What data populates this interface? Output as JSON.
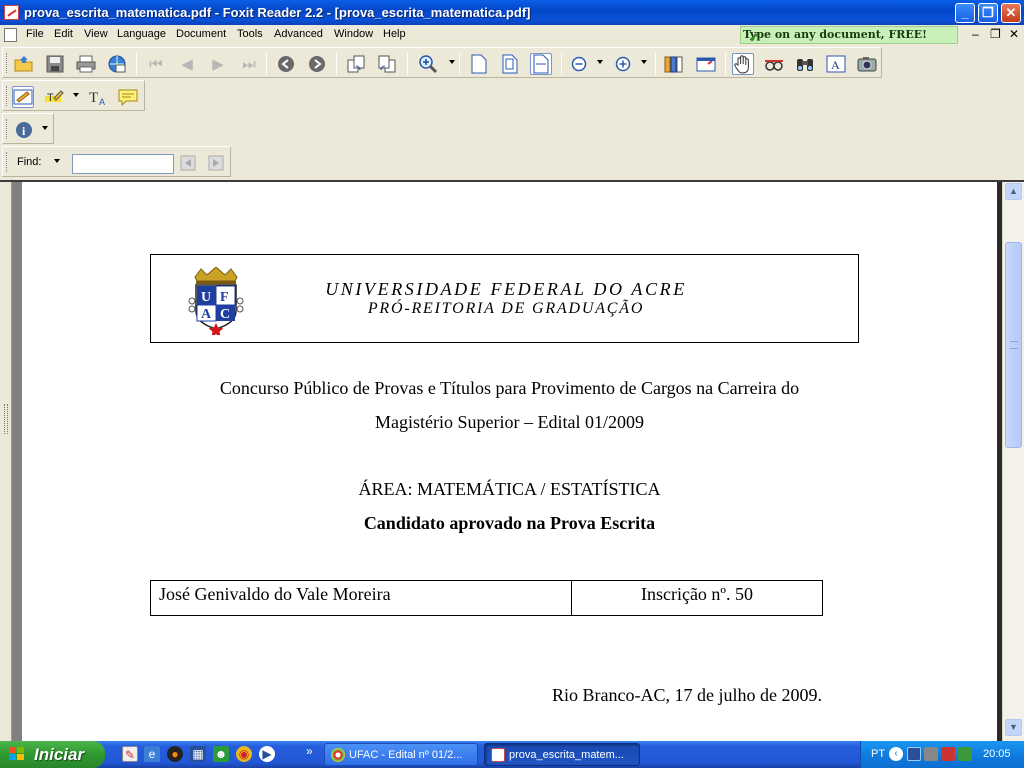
{
  "window": {
    "title": "prova_escrita_matematica.pdf - Foxit Reader 2.2 - [prova_escrita_matematica.pdf]",
    "minimize": "_",
    "restore": "❐",
    "close": "✕"
  },
  "menu": {
    "items": [
      "File",
      "Edit",
      "View",
      "Language",
      "Document",
      "Tools",
      "Advanced",
      "Window",
      "Help"
    ],
    "ad": "Type on any document, FREE!",
    "mdi_minimize": "–",
    "mdi_restore": "❐",
    "mdi_close": "✕"
  },
  "find": {
    "label": "Find:",
    "value": ""
  },
  "document": {
    "univ_name": "UNIVERSIDADE FEDERAL DO ACRE",
    "univ_sub": "PRÓ-REITORIA DE GRADUAÇÃO",
    "seal_letters": [
      "U",
      "F",
      "A",
      "C"
    ],
    "contest_line1": "Concurso Público de Provas e Títulos para Provimento de Cargos na Carreira do",
    "contest_line2": "Magistério Superior – Edital 01/2009",
    "area": "ÁREA: MATEMÁTICA / ESTATÍSTICA",
    "approved_heading": "Candidato aprovado na Prova Escrita",
    "result": {
      "name": "José Genivaldo do Vale Moreira",
      "inscricao": "Inscrição nº. 50"
    },
    "date_line": "Rio Branco-AC, 17 de julho de 2009."
  },
  "taskbar": {
    "start_label": "Iniciar",
    "tasks": [
      {
        "label": "UFAC - Edital nº 01/2..."
      },
      {
        "label": "prova_escrita_matem..."
      }
    ],
    "overflow": "»",
    "language": "PT",
    "clock": "20:05"
  },
  "colors": {
    "titlebar": "#0347c8",
    "taskbar": "#245edc",
    "start": "#2f9a2f",
    "tray": "#0f7ddf",
    "seal_blue": "#1f3fa0",
    "seal_gold": "#c9a227",
    "seal_star": "#d01818"
  }
}
